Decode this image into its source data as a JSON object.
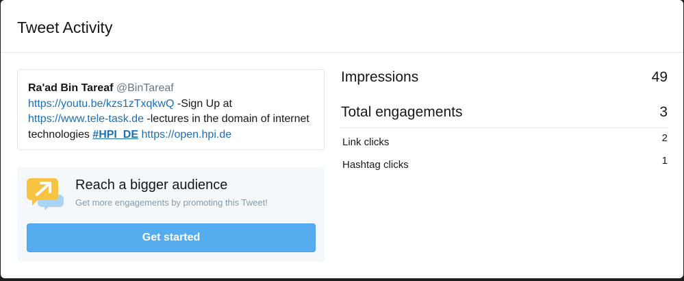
{
  "modal": {
    "title": "Tweet Activity"
  },
  "tweet": {
    "name": "Ra'ad Bin Tareaf",
    "handle": "@BinTareaf",
    "link1": "https://youtu.be/kzs1zTxqkwQ",
    "text1": "  -Sign Up at",
    "link2": "https://www.tele-task.de",
    "text2": "  -lectures in the domain of internet technologies ",
    "hashtag": "#HPI_DE",
    "link3": "https://open.hpi.de"
  },
  "promo": {
    "icon": "megaphone-arrow-icon",
    "title": "Reach a bigger audience",
    "subtitle": "Get more engagements by promoting this Tweet!",
    "button_label": "Get started"
  },
  "metrics": {
    "impressions_label": "Impressions",
    "impressions_value": "49",
    "engagements_label": "Total engagements",
    "engagements_value": "3",
    "breakdown": [
      {
        "label": "Link clicks",
        "value": "2"
      },
      {
        "label": "Hashtag clicks",
        "value": "1"
      }
    ]
  },
  "colors": {
    "accent": "#55acee",
    "link": "#1b6fb5",
    "icon_yellow": "#f6c342",
    "icon_blue": "#a9d4f5"
  }
}
